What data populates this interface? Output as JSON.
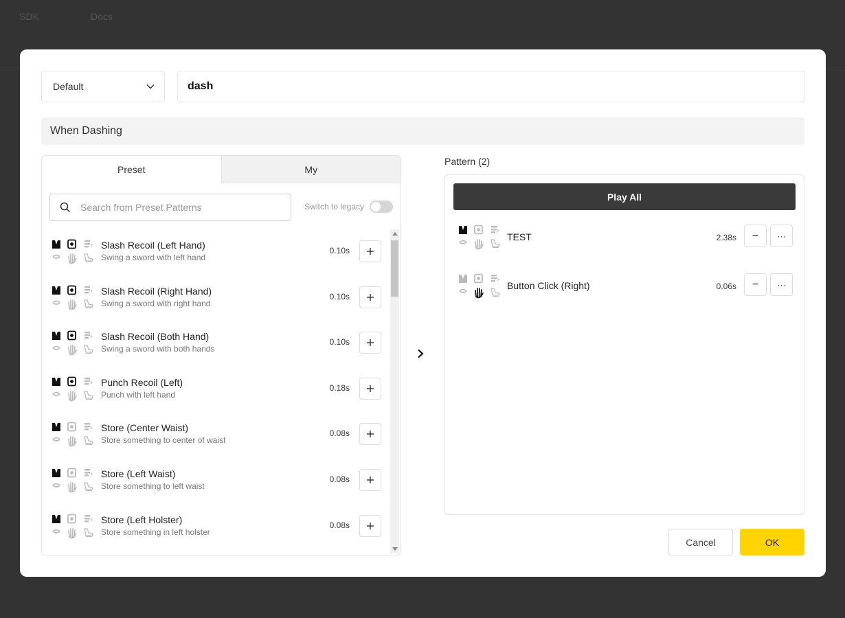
{
  "nav": {
    "items": [
      "SDK",
      "Docs"
    ]
  },
  "header": {
    "device_select": {
      "value": "Default"
    },
    "name_input": {
      "value": "dash"
    },
    "section_title": "When Dashing"
  },
  "left": {
    "tabs": [
      {
        "label": "Preset",
        "active": true
      },
      {
        "label": "My",
        "active": false
      }
    ],
    "search": {
      "placeholder": "Search from Preset Patterns",
      "value": ""
    },
    "legacy_label": "Switch to legacy",
    "legacy_enabled": false,
    "items": [
      {
        "title": "Slash Recoil (Left Hand)",
        "desc": "Swing a sword with left hand",
        "duration": "0.10s",
        "vest_active": true,
        "tac_active": true,
        "hand_active": false
      },
      {
        "title": "Slash Recoil (Right Hand)",
        "desc": "Swing a sword with right hand",
        "duration": "0.10s",
        "vest_active": true,
        "tac_active": true,
        "hand_active": false
      },
      {
        "title": "Slash Recoil (Both Hand)",
        "desc": "Swing a sword with both hands",
        "duration": "0.10s",
        "vest_active": true,
        "tac_active": true,
        "hand_active": false
      },
      {
        "title": "Punch Recoil (Left)",
        "desc": "Punch with left hand",
        "duration": "0.18s",
        "vest_active": true,
        "tac_active": true,
        "hand_active": false
      },
      {
        "title": "Store (Center Waist)",
        "desc": "Store something to center of waist",
        "duration": "0.08s",
        "vest_active": true,
        "tac_active": false,
        "hand_active": false
      },
      {
        "title": "Store (Left Waist)",
        "desc": "Store something to left waist",
        "duration": "0.08s",
        "vest_active": true,
        "tac_active": false,
        "hand_active": false
      },
      {
        "title": "Store (Left Holster)",
        "desc": "Store something in left holster",
        "duration": "0.08s",
        "vest_active": true,
        "tac_active": false,
        "hand_active": false
      }
    ]
  },
  "right": {
    "pattern_label": "Pattern (2)",
    "play_all_label": "Play All",
    "items": [
      {
        "title": "TEST",
        "duration": "2.38s",
        "vest_active": true,
        "tac_active": false,
        "hand_active": false,
        "remove_label": "−",
        "more_label": "···"
      },
      {
        "title": "Button Click (Right)",
        "duration": "0.06s",
        "vest_active": false,
        "tac_active": false,
        "hand_active": true,
        "remove_label": "−",
        "more_label": "···"
      }
    ]
  },
  "move_arrow": "›",
  "footer": {
    "cancel_label": "Cancel",
    "ok_label": "OK"
  },
  "colors": {
    "accent": "#ffd400",
    "dark_button": "#3a3a3a",
    "icon_active": "#111111",
    "icon_inactive": "#bbbbbb"
  },
  "icons": [
    "vest-icon",
    "tactal-icon",
    "arms-icon",
    "head-icon",
    "hand-icon",
    "foot-icon",
    "search-icon",
    "chevron-down-icon",
    "plus-icon",
    "minus-icon",
    "more-icon",
    "chevron-right-icon"
  ]
}
